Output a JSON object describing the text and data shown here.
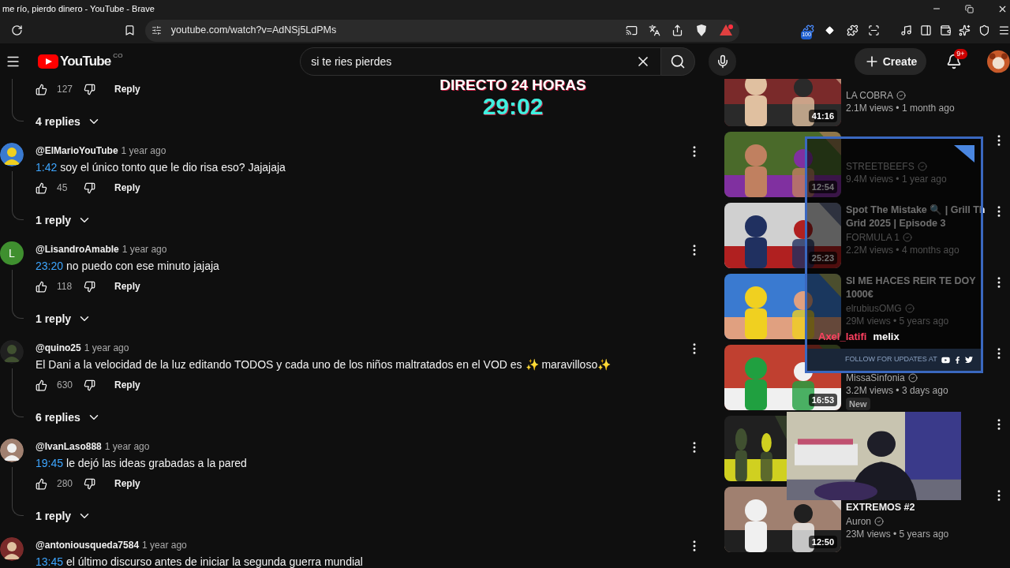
{
  "browser": {
    "title": "me río, pierdo dinero - YouTube - Brave",
    "url": "youtube.com/watch?v=AdNSj5LdPMs",
    "extension_badge": "100"
  },
  "youtube": {
    "logo": "YouTube",
    "country": "CO",
    "search": {
      "value": "si te ries pierdes"
    },
    "create": "Create",
    "notifications": "9+"
  },
  "stream_overlay": {
    "heading": "DIRECTO 24 HORAS",
    "timer": "29:02",
    "chat_user": "Axel_latifi",
    "chat_message": "melix",
    "footer": "FOLLOW FOR UPDATES AT"
  },
  "comments": [
    {
      "kind": "partial",
      "likes": "127",
      "reply": "Reply",
      "replies": "4 replies"
    },
    {
      "kind": "picture",
      "handle": "@ElMarioYouTube",
      "time": "1 year ago",
      "timestamp": "1:42",
      "text": "soy el único tonto que le dio risa eso? Jajajaja",
      "likes": "45",
      "reply": "Reply",
      "replies": "1 reply"
    },
    {
      "kind": "letter",
      "letter": "L",
      "handle": "@LisandroAmable",
      "time": "1 year ago",
      "timestamp": "23:20",
      "text": "no puedo con ese minuto jajaja",
      "likes": "118",
      "reply": "Reply",
      "replies": "1 reply"
    },
    {
      "kind": "picture",
      "handle": "@quino25",
      "time": "1 year ago",
      "text": "El Dani a la velocidad de la luz editando TODOS y cada uno de los niños maltratados en el VOD es ✨ maravilloso✨",
      "likes": "630",
      "reply": "Reply",
      "replies": "6 replies"
    },
    {
      "kind": "picture",
      "handle": "@IvanLaso888",
      "time": "1 year ago",
      "timestamp": "19:45",
      "text": "le dejó las ideas grabadas a la pared",
      "likes": "280",
      "reply": "Reply",
      "replies": "1 reply"
    },
    {
      "kind": "picture",
      "handle": "@antoniousqueda7584",
      "time": "1 year ago",
      "timestamp": "13:45",
      "text": "el último discurso antes de iniciar la segunda guerra mundial"
    }
  ],
  "videos": [
    {
      "kind": "video",
      "channel": "LA COBRA",
      "meta": "2.1M views • 1 month ago",
      "duration": "41:16"
    },
    {
      "kind": "video",
      "channel": "STREETBEEFS",
      "meta": "9.4M views • 1 year ago",
      "duration": "12:54"
    },
    {
      "kind": "video",
      "title": [
        "Spot The Mistake 🔍 | Grill Th",
        "Grid 2025 | Episode 3"
      ],
      "channel": "FORMULA 1",
      "meta": "2.2M views • 4 months ago",
      "duration": "25:23"
    },
    {
      "kind": "video",
      "title": [
        "SI ME HACES REIR TE DOY",
        "1000€"
      ],
      "channel": "elrubiusOMG",
      "meta": "29M views • 5 years ago"
    },
    {
      "kind": "video",
      "channel": "MissaSinfonia",
      "meta": "3.2M views • 3 days ago",
      "duration": "16:53",
      "badge": "New"
    },
    {
      "kind": "covered"
    },
    {
      "kind": "video",
      "title": [
        "EXTREMOS #2"
      ],
      "channel": "Auron",
      "meta": "23M views • 5 years ago",
      "duration": "12:50"
    }
  ]
}
